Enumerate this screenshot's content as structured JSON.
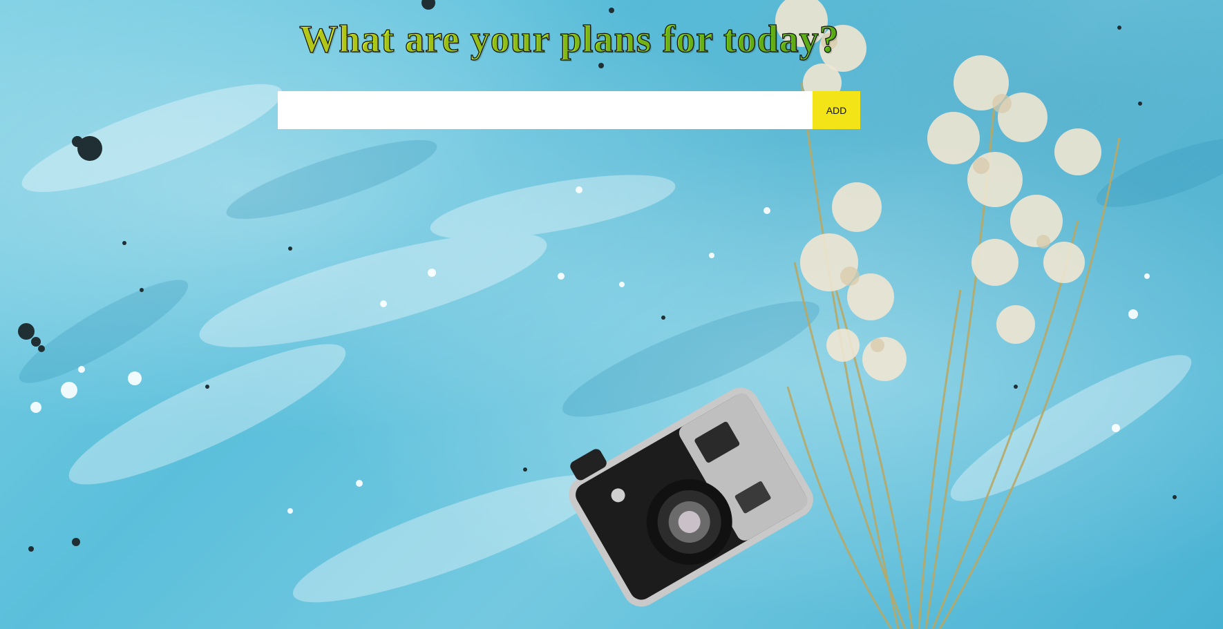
{
  "header": {
    "title": "What are your plans for today?"
  },
  "todo_form": {
    "input_value": "",
    "input_placeholder": "",
    "add_label": "ADD"
  },
  "colors": {
    "add_button": "#f2e416",
    "background_accent": "#5bbfdb",
    "title_gradient_start": "#f4f21e",
    "title_gradient_end": "#42b21a"
  },
  "background": {
    "decorations": [
      "camera-photo",
      "dried-flowers-photo",
      "paint-splatter-texture"
    ]
  }
}
